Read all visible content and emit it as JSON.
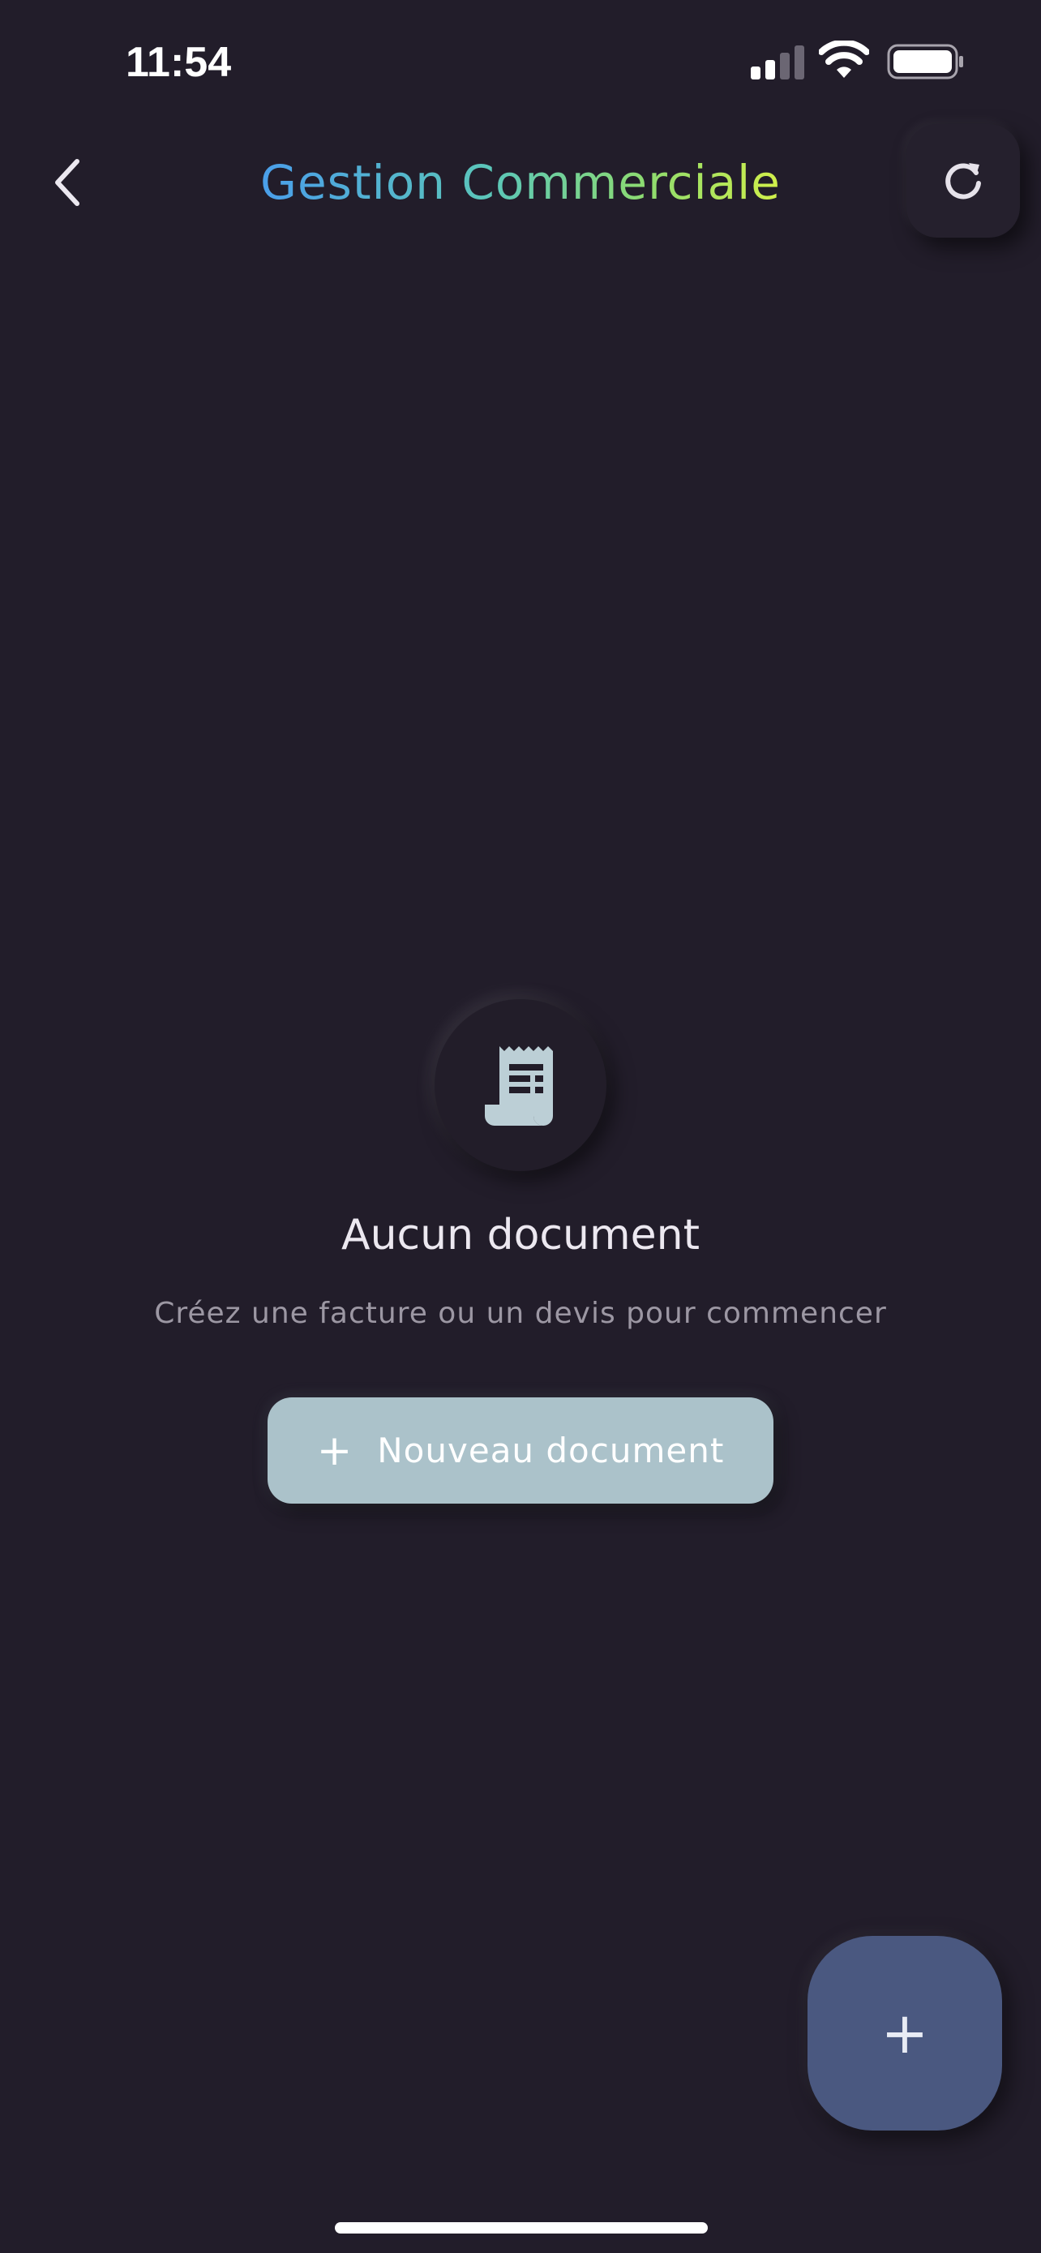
{
  "status_bar": {
    "time": "11:54",
    "icons": [
      "cellular-signal-icon",
      "wifi-icon",
      "battery-icon"
    ]
  },
  "header": {
    "title": "Gestion Commerciale",
    "back_icon": "chevron-left-icon",
    "refresh_icon": "refresh-icon",
    "title_gradient": [
      "#4a9eea",
      "#5cc7b8",
      "#8fdc6e",
      "#d2f04a"
    ]
  },
  "empty_state": {
    "icon": "receipt-icon",
    "title": "Aucun document",
    "subtitle": "Créez une facture ou un devis pour commencer",
    "button_icon": "plus-icon",
    "button_label": "Nouveau document"
  },
  "fab": {
    "icon": "plus-icon",
    "symbol": "+"
  },
  "colors": {
    "background": "#221d2a",
    "primary_button": "#abc2ca",
    "fab": "#4a5880",
    "subtitle_text": "#9c97a3"
  }
}
